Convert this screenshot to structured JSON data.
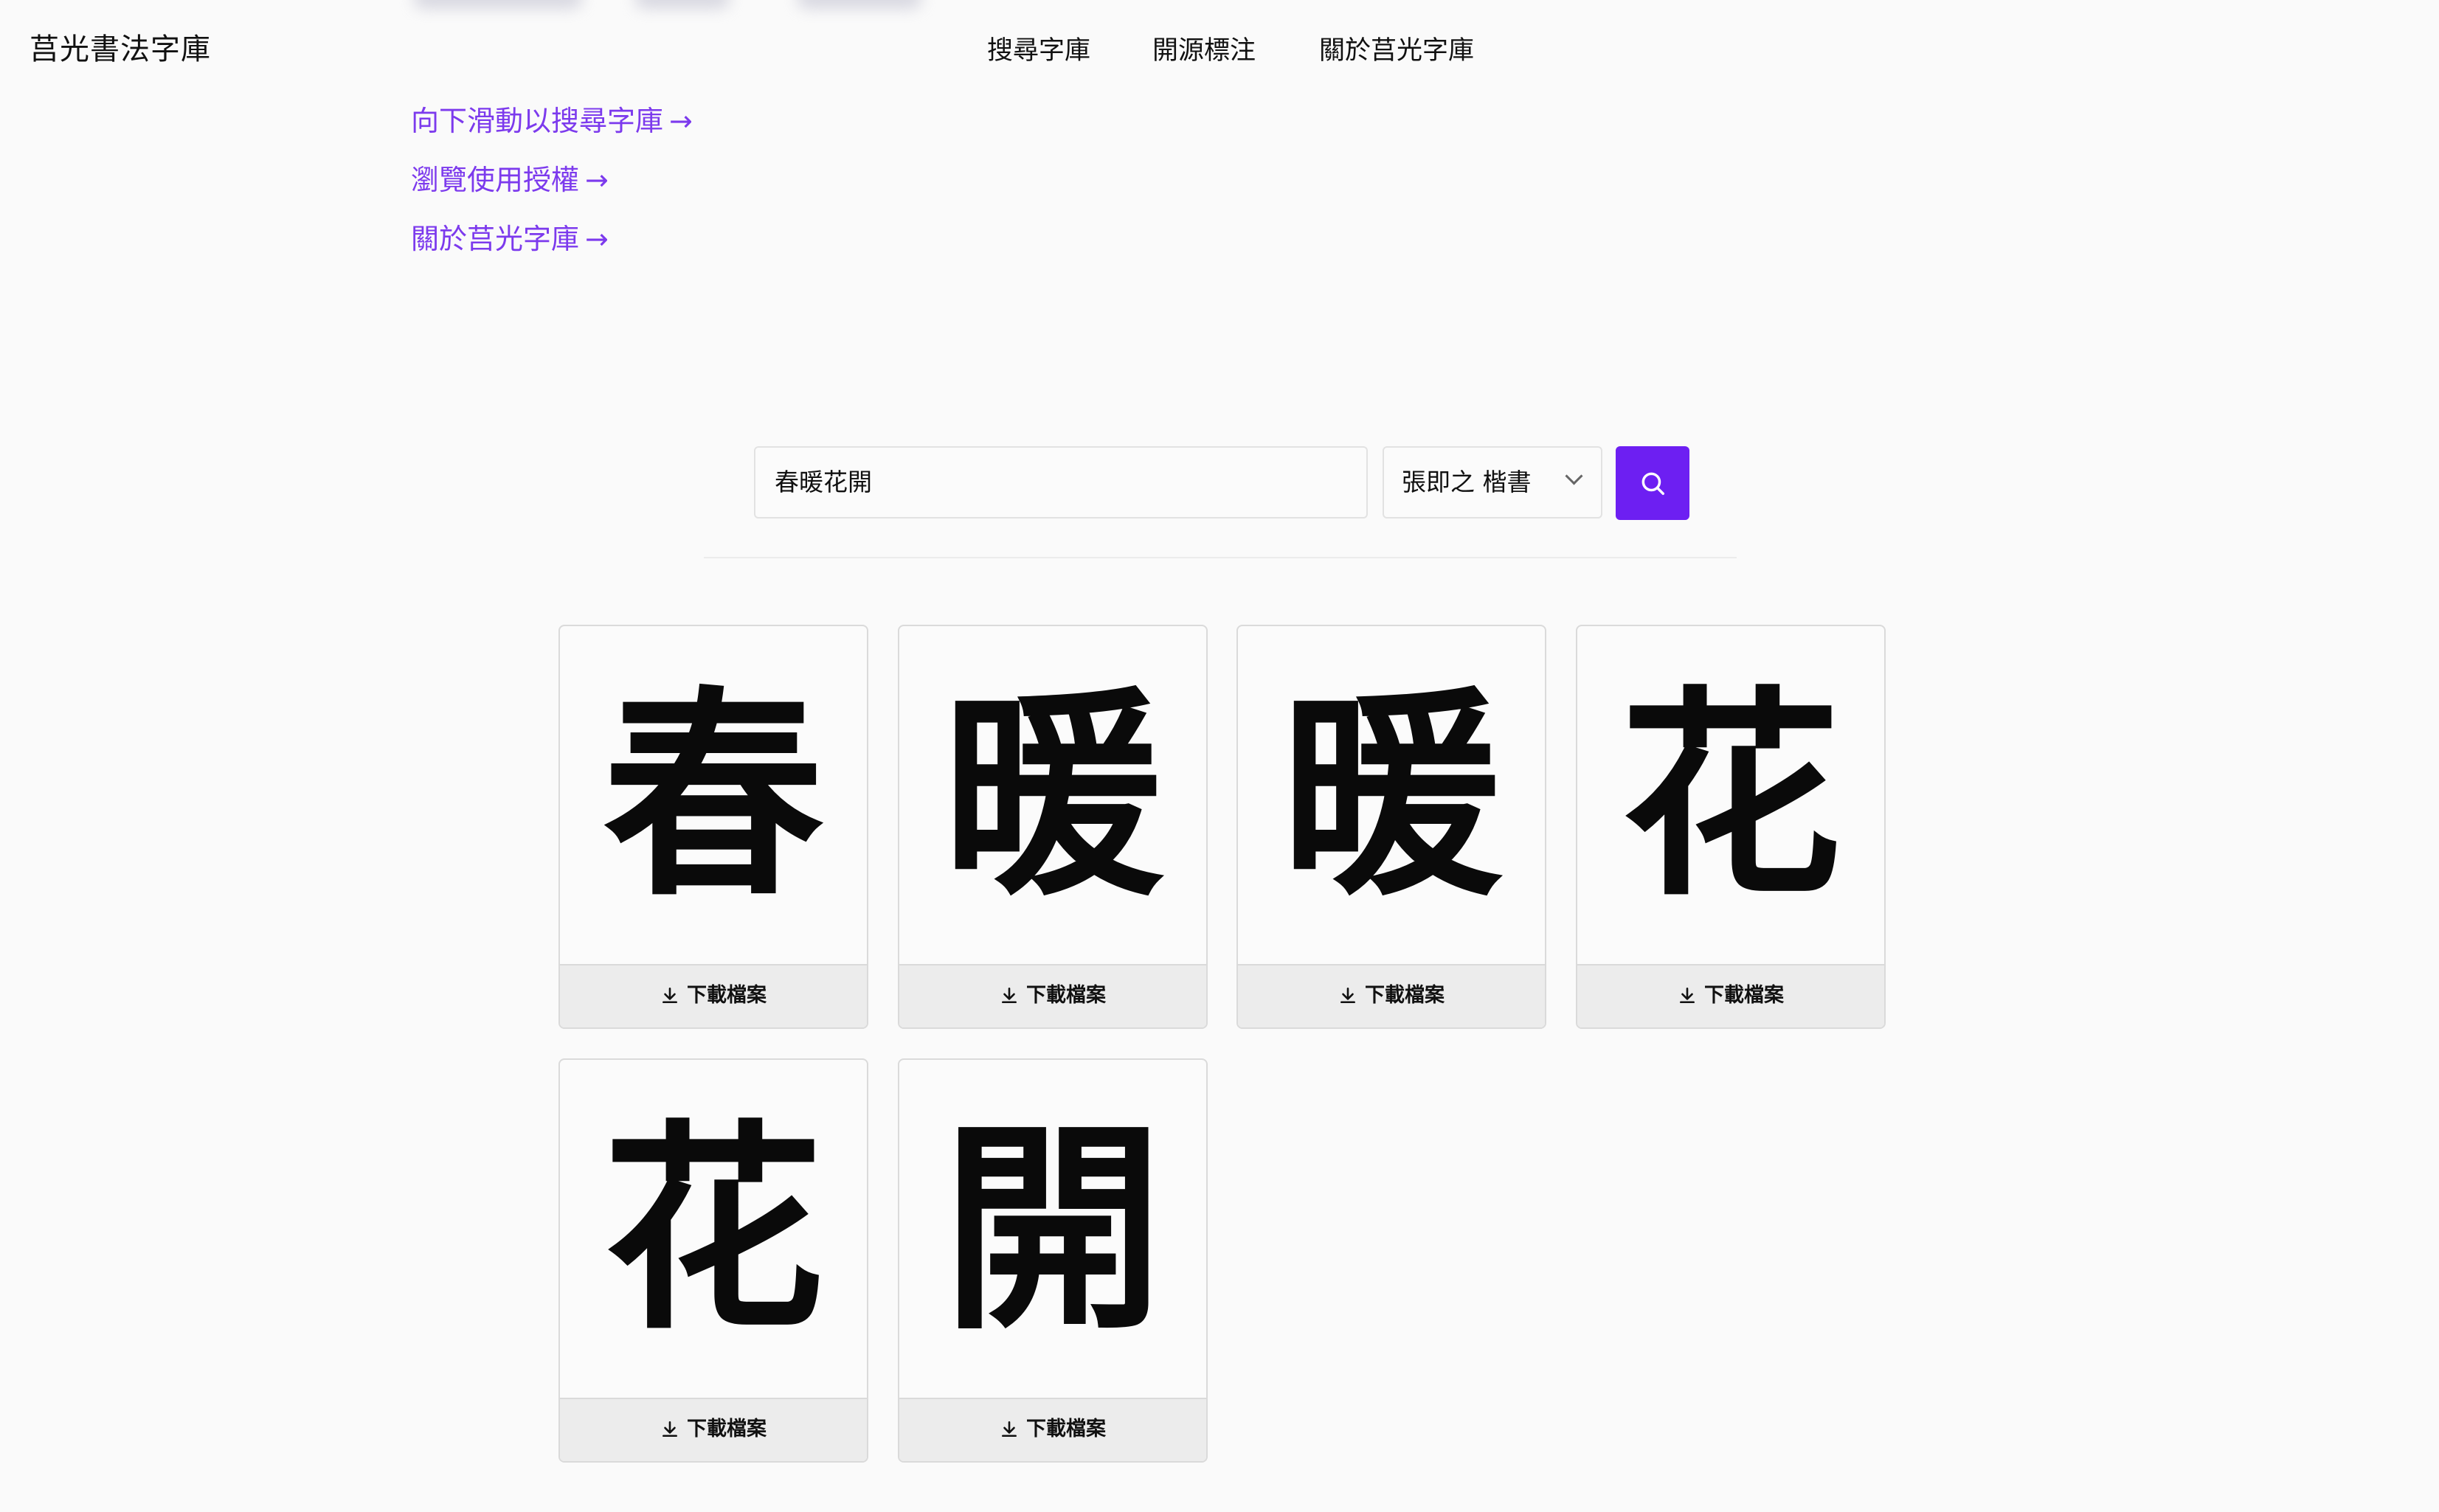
{
  "header": {
    "logo": "莒光書法字庫",
    "nav": [
      "搜尋字庫",
      "開源標注",
      "關於莒光字庫"
    ]
  },
  "links": [
    {
      "label": "向下滑動以搜尋字庫",
      "arrow": "→"
    },
    {
      "label": "瀏覽使用授權",
      "arrow": "→"
    },
    {
      "label": "關於莒光字庫",
      "arrow": "→"
    }
  ],
  "search": {
    "query": "春暖花開",
    "font": "張即之 楷書"
  },
  "results": [
    {
      "char": "春",
      "download_label": "下載檔案"
    },
    {
      "char": "暖",
      "download_label": "下載檔案"
    },
    {
      "char": "暖",
      "download_label": "下載檔案"
    },
    {
      "char": "花",
      "download_label": "下載檔案"
    },
    {
      "char": "花",
      "download_label": "下載檔案"
    },
    {
      "char": "開",
      "download_label": "下載檔案"
    }
  ],
  "colors": {
    "accent": "#7c3aed",
    "button": "#6d1ff2",
    "background": "#fafafa"
  }
}
